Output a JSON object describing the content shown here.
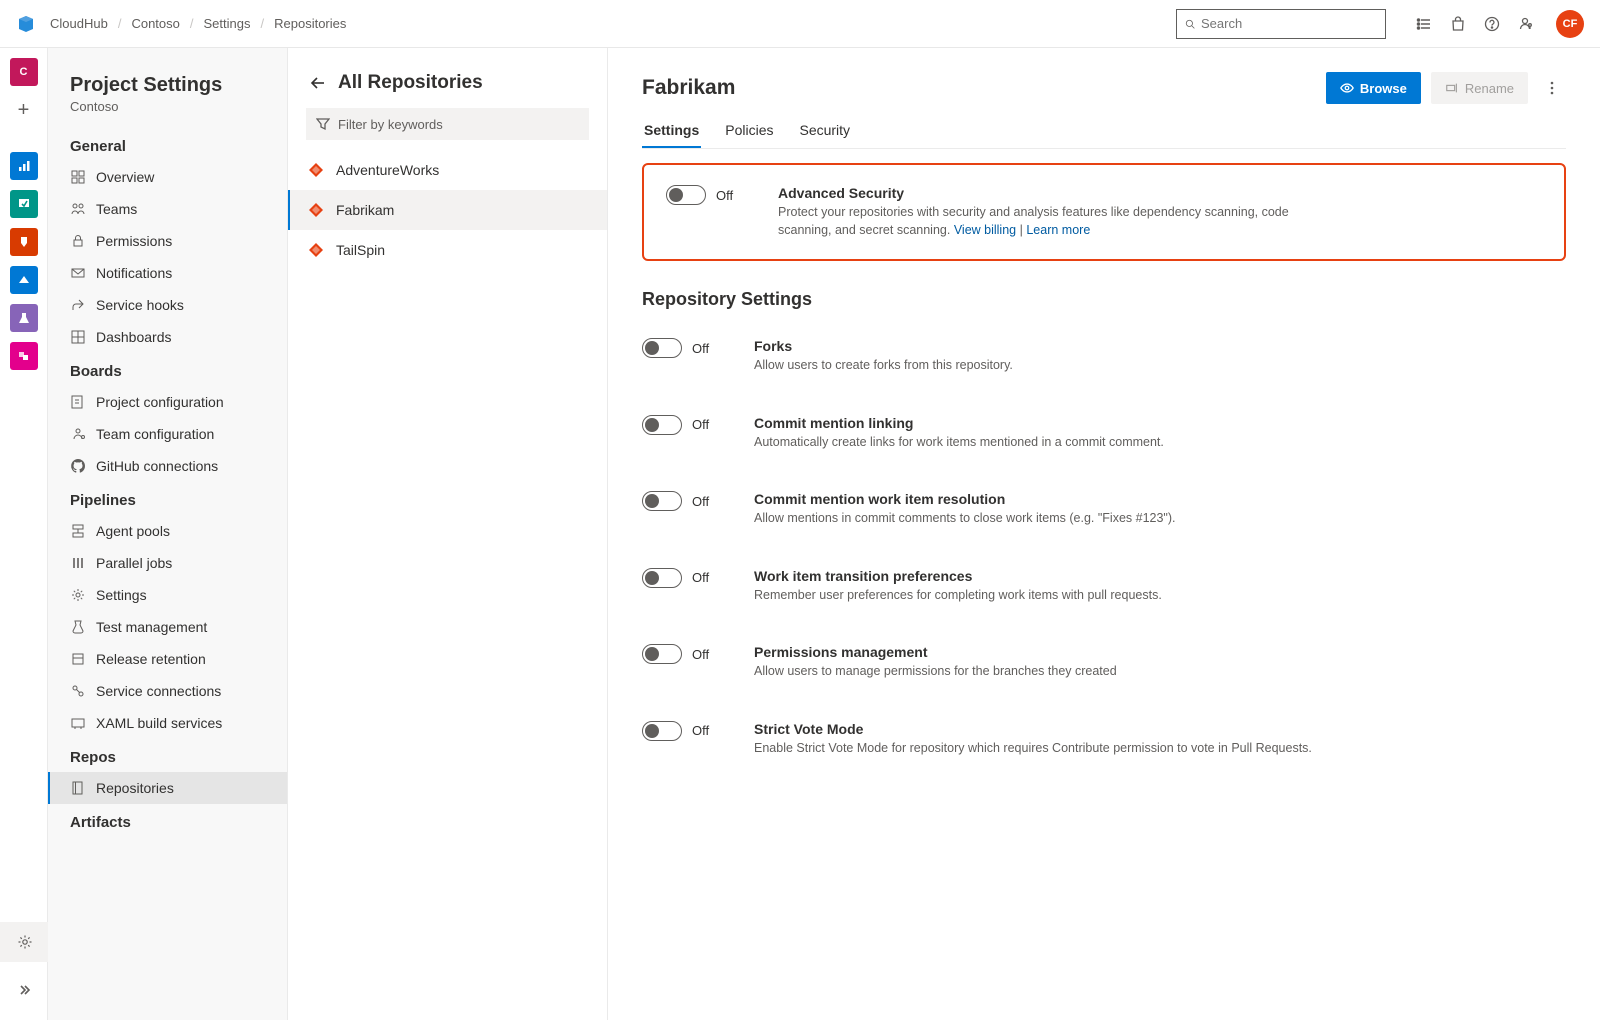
{
  "topbar": {
    "product": "CloudHub",
    "crumbs": [
      "Contoso",
      "Settings",
      "Repositories"
    ],
    "search_placeholder": "Search",
    "avatar_initials": "CF"
  },
  "panelSettings": {
    "title": "Project Settings",
    "project": "Contoso",
    "sections": [
      {
        "name": "General",
        "items": [
          "Overview",
          "Teams",
          "Permissions",
          "Notifications",
          "Service hooks",
          "Dashboards"
        ]
      },
      {
        "name": "Boards",
        "items": [
          "Project configuration",
          "Team configuration",
          "GitHub connections"
        ]
      },
      {
        "name": "Pipelines",
        "items": [
          "Agent pools",
          "Parallel jobs",
          "Settings",
          "Test management",
          "Release retention",
          "Service connections",
          "XAML build services"
        ]
      },
      {
        "name": "Repos",
        "items": [
          "Repositories"
        ]
      },
      {
        "name": "Artifacts",
        "items": []
      }
    ],
    "activeItem": "Repositories"
  },
  "panelRepos": {
    "title": "All Repositories",
    "filter_placeholder": "Filter by keywords",
    "items": [
      "AdventureWorks",
      "Fabrikam",
      "TailSpin"
    ],
    "selected": "Fabrikam"
  },
  "main": {
    "title": "Fabrikam",
    "browse_label": "Browse",
    "rename_label": "Rename",
    "tabs": [
      "Settings",
      "Policies",
      "Security"
    ],
    "activeTab": "Settings",
    "advanced": {
      "toggle": "Off",
      "title": "Advanced Security",
      "desc_a": "Protect your repositories with security and analysis features like dependency scanning, code scanning, and secret scanning. ",
      "link1": "View billing",
      "link2": "Learn more"
    },
    "section_title": "Repository Settings",
    "settings": [
      {
        "toggle": "Off",
        "title": "Forks",
        "desc": "Allow users to create forks from this repository."
      },
      {
        "toggle": "Off",
        "title": "Commit mention linking",
        "desc": "Automatically create links for work items mentioned in a commit comment."
      },
      {
        "toggle": "Off",
        "title": "Commit mention work item resolution",
        "desc": "Allow mentions in commit comments to close work items (e.g. \"Fixes #123\")."
      },
      {
        "toggle": "Off",
        "title": "Work item transition preferences",
        "desc": "Remember user preferences for completing work items with pull requests."
      },
      {
        "toggle": "Off",
        "title": "Permissions management",
        "desc": "Allow users to manage permissions for the branches they created"
      },
      {
        "toggle": "Off",
        "title": "Strict Vote Mode",
        "desc": "Enable Strict Vote Mode for repository which requires Contribute permission to vote in Pull Requests."
      }
    ]
  }
}
